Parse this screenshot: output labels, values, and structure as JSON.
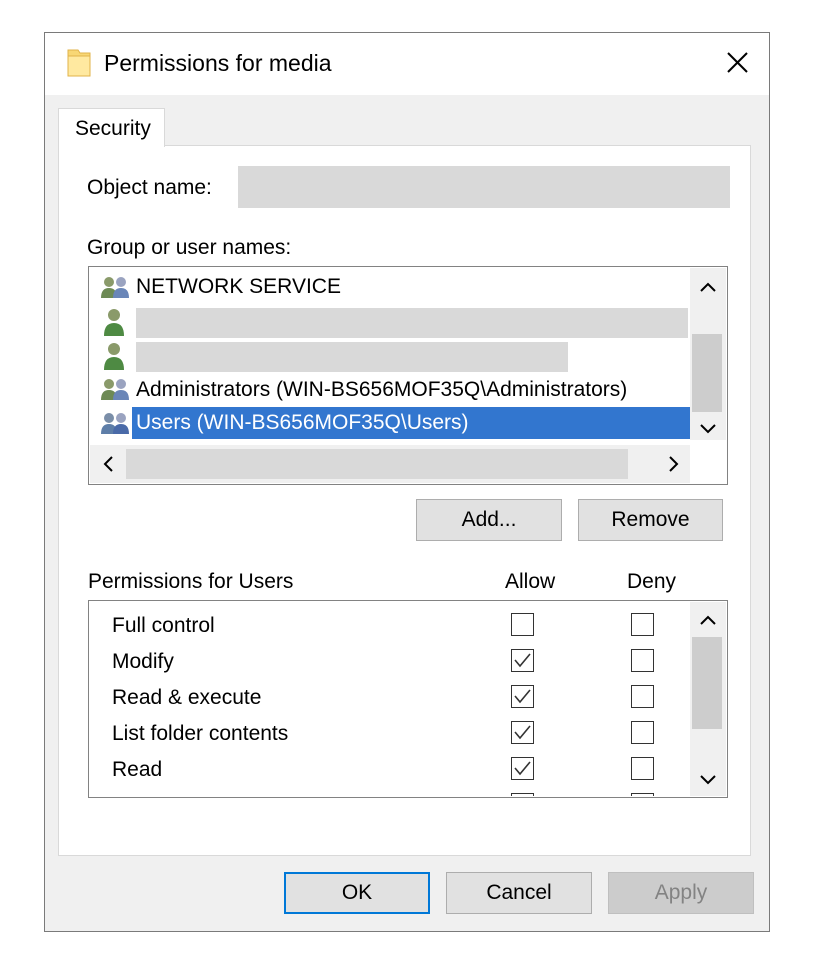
{
  "window": {
    "title": "Permissions for media",
    "close_symbol": "✕",
    "folder_icon": "folder-icon"
  },
  "tabs": [
    {
      "label": "Security"
    }
  ],
  "object_name": {
    "label": "Object name:",
    "value": ""
  },
  "groups": {
    "label": "Group or user names:",
    "items": [
      {
        "name": "NETWORK SERVICE",
        "icon": "group-icon",
        "selected": false
      },
      {
        "name": "",
        "icon": "user-icon",
        "selected": false
      },
      {
        "name": "",
        "icon": "user-icon",
        "selected": false
      },
      {
        "name": "Administrators (WIN-BS656MOF35Q\\Administrators)",
        "icon": "group-icon",
        "selected": false
      },
      {
        "name": "Users (WIN-BS656MOF35Q\\Users)",
        "icon": "group-icon",
        "selected": true
      }
    ],
    "add_button": "Add...",
    "remove_button": "Remove"
  },
  "permissions": {
    "label": "Permissions for Users",
    "allow_header": "Allow",
    "deny_header": "Deny",
    "rows": [
      {
        "name": "Full control",
        "allow": false,
        "deny": false
      },
      {
        "name": "Modify",
        "allow": true,
        "deny": false
      },
      {
        "name": "Read & execute",
        "allow": true,
        "deny": false
      },
      {
        "name": "List folder contents",
        "allow": true,
        "deny": false
      },
      {
        "name": "Read",
        "allow": true,
        "deny": false
      }
    ]
  },
  "footer": {
    "ok": "OK",
    "cancel": "Cancel",
    "apply": "Apply"
  },
  "colors": {
    "selection": "#3276cf",
    "accent_border": "#0078d7"
  }
}
